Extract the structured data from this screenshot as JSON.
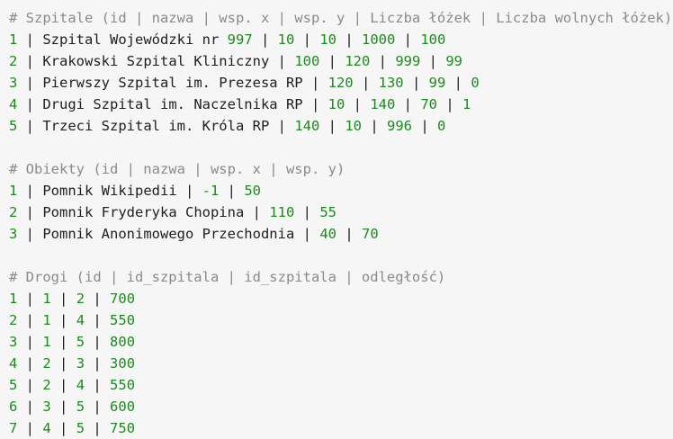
{
  "sections": [
    {
      "comment": "# Szpitale (id | nazwa | wsp. x | wsp. y | Liczba łóżek | Liczba wolnych łóżek)",
      "rows": [
        {
          "id": "1",
          "text": "Szpital Wojewódzki nr",
          "nums": [
            "997",
            "10",
            "10",
            "1000",
            "100"
          ]
        },
        {
          "id": "2",
          "text": "Krakowski Szpital Kliniczny",
          "nums": [
            "100",
            "120",
            "999",
            "99"
          ]
        },
        {
          "id": "3",
          "text": "Pierwszy Szpital im. Prezesa RP",
          "nums": [
            "120",
            "130",
            "99",
            "0"
          ]
        },
        {
          "id": "4",
          "text": "Drugi Szpital im. Naczelnika RP",
          "nums": [
            "10",
            "140",
            "70",
            "1"
          ]
        },
        {
          "id": "5",
          "text": "Trzeci Szpital im. Króla RP",
          "nums": [
            "140",
            "10",
            "996",
            "0"
          ]
        }
      ]
    },
    {
      "comment": "# Obiekty (id | nazwa | wsp. x | wsp. y)",
      "rows": [
        {
          "id": "1",
          "text": "Pomnik Wikipedii",
          "nums": [
            "-1",
            "50"
          ]
        },
        {
          "id": "2",
          "text": "Pomnik Fryderyka Chopina",
          "nums": [
            "110",
            "55"
          ]
        },
        {
          "id": "3",
          "text": "Pomnik Anonimowego Przechodnia",
          "nums": [
            "40",
            "70"
          ]
        }
      ]
    },
    {
      "comment": "# Drogi (id | id_szpitala | id_szpitala | odległość)",
      "rows": [
        {
          "id": "1",
          "text": "",
          "nums": [
            "1",
            "2",
            "700"
          ]
        },
        {
          "id": "2",
          "text": "",
          "nums": [
            "1",
            "4",
            "550"
          ]
        },
        {
          "id": "3",
          "text": "",
          "nums": [
            "1",
            "5",
            "800"
          ]
        },
        {
          "id": "4",
          "text": "",
          "nums": [
            "2",
            "3",
            "300"
          ]
        },
        {
          "id": "5",
          "text": "",
          "nums": [
            "2",
            "4",
            "550"
          ]
        },
        {
          "id": "6",
          "text": "",
          "nums": [
            "3",
            "5",
            "600"
          ]
        },
        {
          "id": "7",
          "text": "",
          "nums": [
            "4",
            "5",
            "750"
          ]
        }
      ]
    }
  ],
  "colors": {
    "background": "#f6f6f6",
    "comment": "#8a8a8a",
    "number": "#1d8a1d",
    "text": "#1e1e1e"
  }
}
